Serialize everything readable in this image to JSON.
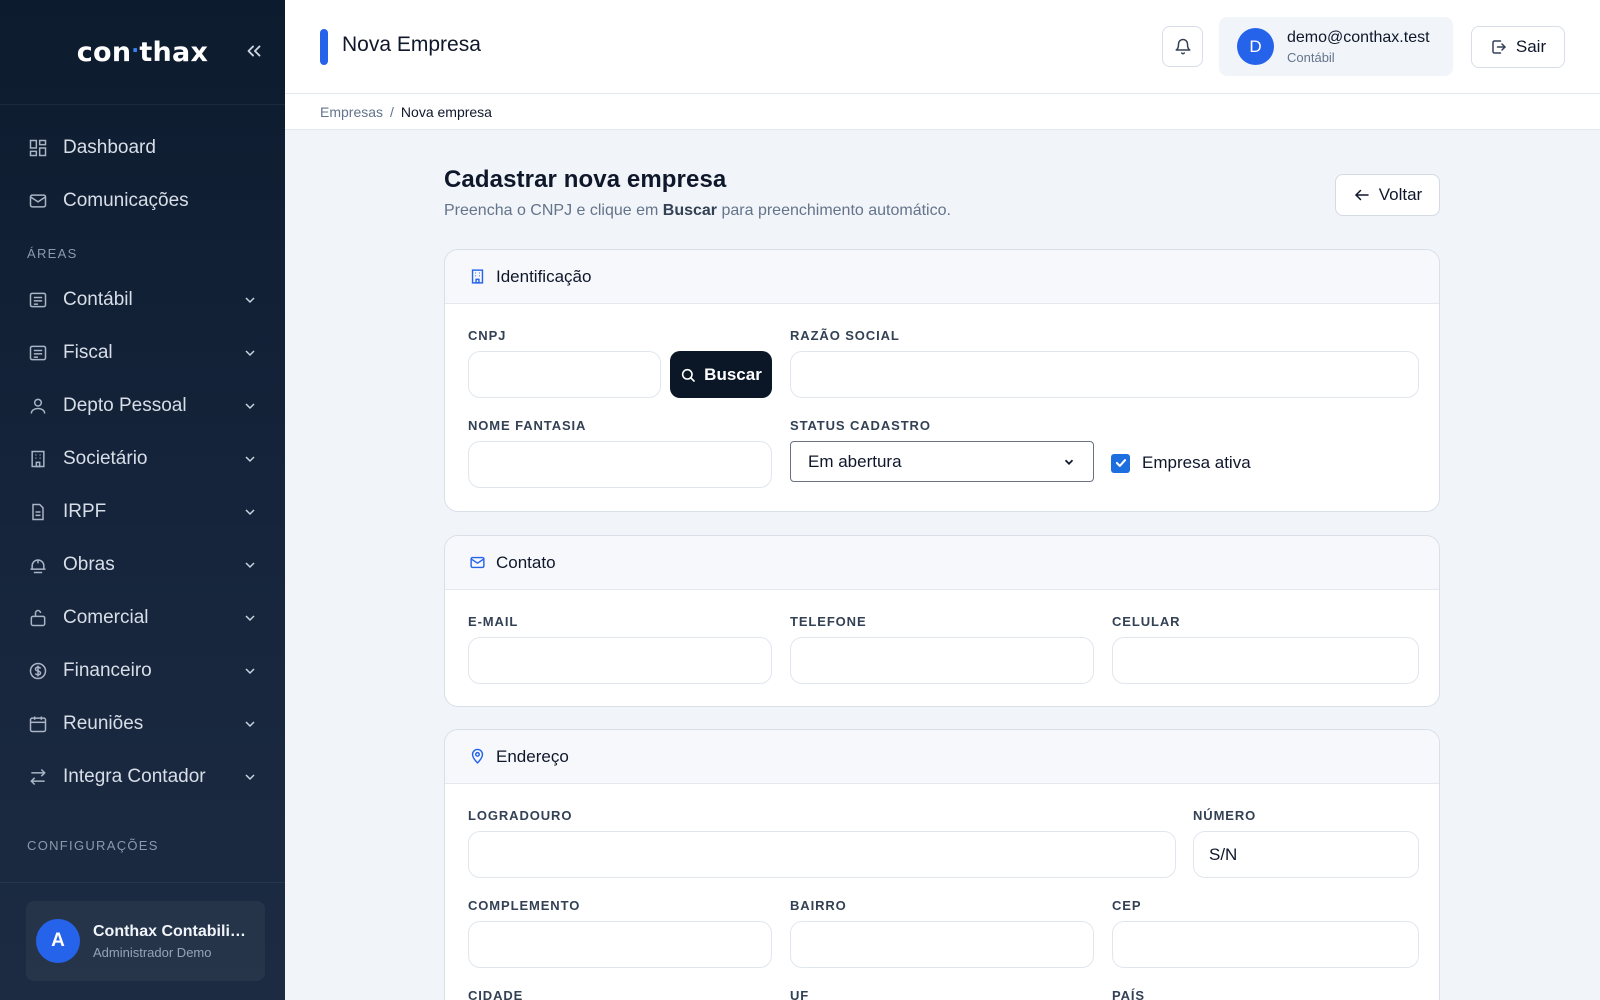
{
  "brand": {
    "logo_left": "con",
    "logo_dot": "·",
    "logo_right": "thax"
  },
  "sidebar": {
    "top_items": [
      {
        "label": "Dashboard",
        "icon": "dashboard-icon"
      },
      {
        "label": "Comunicações",
        "icon": "mail-icon"
      }
    ],
    "areas_title": "ÁREAS",
    "areas": [
      {
        "label": "Contábil",
        "icon": "ledger-icon"
      },
      {
        "label": "Fiscal",
        "icon": "ledger-icon"
      },
      {
        "label": "Depto Pessoal",
        "icon": "user-icon"
      },
      {
        "label": "Societário",
        "icon": "building-icon"
      },
      {
        "label": "IRPF",
        "icon": "document-icon"
      },
      {
        "label": "Obras",
        "icon": "construction-icon"
      },
      {
        "label": "Comercial",
        "icon": "briefcase-icon"
      },
      {
        "label": "Financeiro",
        "icon": "money-icon"
      },
      {
        "label": "Reuniões",
        "icon": "calendar-icon"
      },
      {
        "label": "Integra Contador",
        "icon": "transfer-icon"
      }
    ],
    "config_title": "CONFIGURAÇÕES",
    "user": {
      "avatar": "A",
      "name": "Conthax Contabilidade",
      "role": "Administrador Demo"
    }
  },
  "header": {
    "title": "Nova Empresa",
    "account": {
      "avatar": "D",
      "email": "demo@conthax.test",
      "role": "Contábil"
    },
    "logout_label": "Sair"
  },
  "breadcrumb": {
    "parent": "Empresas",
    "sep": "/",
    "current": "Nova empresa"
  },
  "main": {
    "title": "Cadastrar nova empresa",
    "subtitle_before": "Preencha o CNPJ e clique em ",
    "subtitle_bold": "Buscar",
    "subtitle_after": " para preenchimento automático.",
    "back_label": "Voltar"
  },
  "identificacao": {
    "title": "Identificação",
    "cnpj_label": "CNPJ",
    "cnpj_value": "",
    "buscar_label": "Buscar",
    "razao_label": "RAZÃO SOCIAL",
    "razao_value": "",
    "fantasia_label": "NOME FANTASIA",
    "fantasia_value": "",
    "status_label": "STATUS CADASTRO",
    "status_value": "Em abertura",
    "ativa_label": "Empresa ativa",
    "ativa_checked": true
  },
  "contato": {
    "title": "Contato",
    "email_label": "E-MAIL",
    "email_value": "",
    "telefone_label": "TELEFONE",
    "telefone_value": "",
    "celular_label": "CELULAR",
    "celular_value": ""
  },
  "endereco": {
    "title": "Endereço",
    "logradouro_label": "LOGRADOURO",
    "logradouro_value": "",
    "numero_label": "NÚMERO",
    "numero_value": "S/N",
    "complemento_label": "COMPLEMENTO",
    "complemento_value": "",
    "bairro_label": "BAIRRO",
    "bairro_value": "",
    "cep_label": "CEP",
    "cep_value": "",
    "cidade_label": "CIDADE",
    "uf_label": "UF",
    "pais_label": "PAÍS"
  },
  "colors": {
    "accent": "#2563eb",
    "sidebar_bg": "#0d1b2e",
    "primary_button": "#0b1626"
  }
}
